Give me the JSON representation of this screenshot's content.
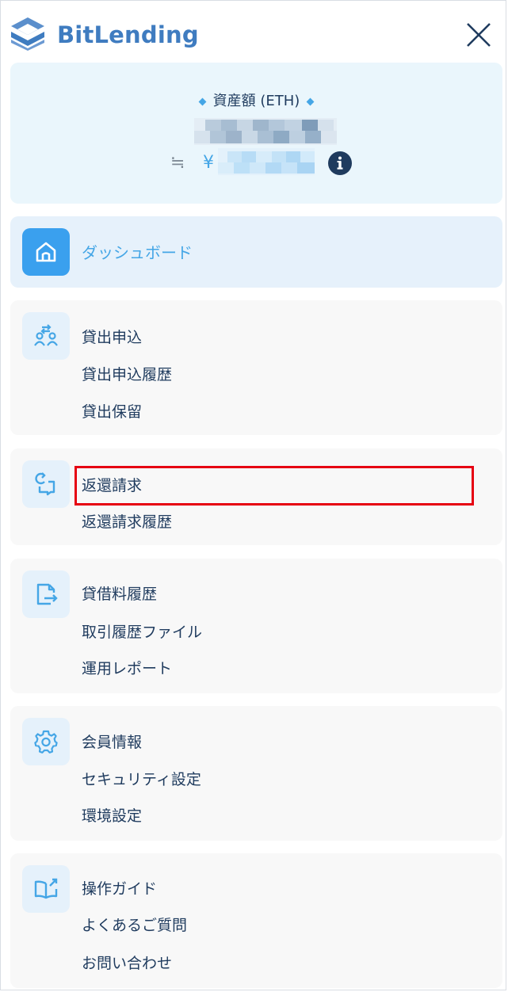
{
  "header": {
    "brand_name": "BitLending",
    "logo_icon": "bitlending-logo-icon",
    "close_icon": "close-icon"
  },
  "assets": {
    "label": "資産額 (ETH)",
    "approx_symbol": "≒",
    "currency_symbol": "¥",
    "info_icon": "info-icon"
  },
  "nav": {
    "dashboard": {
      "icon": "home-icon",
      "label": "ダッシュボード"
    },
    "groups": [
      {
        "icon": "lending-users-icon",
        "items": [
          "貸出申込",
          "貸出申込履歴",
          "貸出保留"
        ]
      },
      {
        "icon": "return-request-icon",
        "items": [
          "返還請求",
          "返還請求履歴"
        ]
      },
      {
        "icon": "document-export-icon",
        "items": [
          "貸借料履歴",
          "取引履歴ファイル",
          "運用レポート"
        ]
      },
      {
        "icon": "gear-icon",
        "items": [
          "会員情報",
          "セキュリティ設定",
          "環境設定"
        ]
      },
      {
        "icon": "guide-book-icon",
        "items": [
          "操作ガイド",
          "よくあるご質問",
          "お問い合わせ"
        ]
      }
    ]
  },
  "colors": {
    "brand_blue": "#3f7cc0",
    "accent_blue": "#45a6e6",
    "text_navy": "#1f3b5e",
    "highlight_red": "#e60012"
  }
}
